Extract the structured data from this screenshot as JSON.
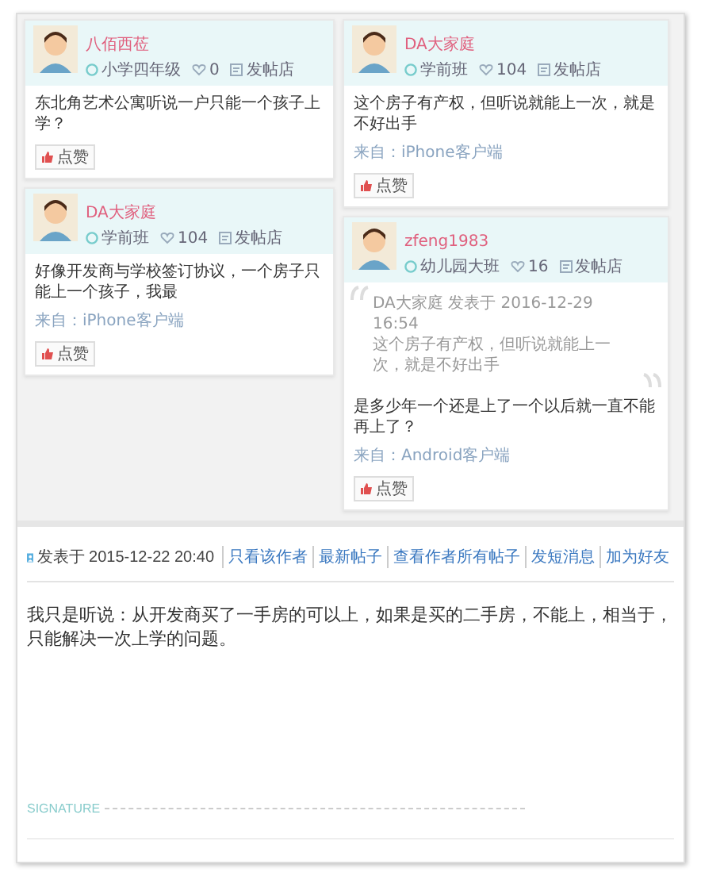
{
  "screenshot": {
    "columns": [
      [
        {
          "name": "八佰西莅",
          "level": "小学四年级",
          "count": "0",
          "posts_label": "发帖店",
          "text": "东北角艺术公寓听说一户只能一个孩子上学？",
          "like": "点赞"
        },
        {
          "name": "DA大家庭",
          "level": "学前班",
          "count": "104",
          "posts_label": "发帖店",
          "text": "好像开发商与学校签订协议，一个房子只能上一个孩子，我最",
          "source": "来自：iPhone客户端",
          "like": "点赞"
        }
      ],
      [
        {
          "name": "DA大家庭",
          "level": "学前班",
          "count": "104",
          "posts_label": "发帖店",
          "text": "这个房子有产权，但听说就能上一次，就是不好出手",
          "source": "来自：iPhone客户端",
          "like": "点赞"
        },
        {
          "name": "zfeng1983",
          "level": "幼儿园大班",
          "count": "16",
          "posts_label": "发帖店",
          "quote": {
            "author": "DA大家庭 发表于 2016-12-29 16:54",
            "text": "这个房子有产权，但听说就能上一次，就是不好出手"
          },
          "text": "是多少年一个还是上了一个以后就一直不能再上了？",
          "source": "来自：Android客户端",
          "like": "点赞"
        }
      ]
    ]
  },
  "post": {
    "posted": "发表于 2015-12-22 20:40",
    "links": [
      "只看该作者",
      "最新帖子",
      "查看作者所有帖子",
      "发短消息",
      "加为好友"
    ],
    "body": "我只是听说：从开发商买了一手房的可以上，如果是买的二手房，不能上，相当于，只能解决一次上学的问题。",
    "signature": "SIGNATURE"
  }
}
